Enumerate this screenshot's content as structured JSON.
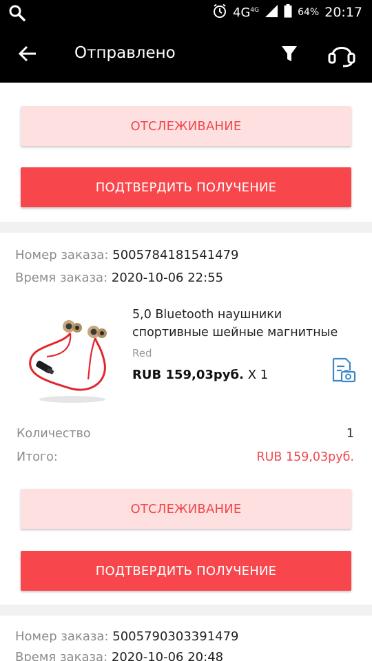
{
  "status_bar": {
    "network": "4G",
    "network_sup": "4G",
    "battery": "64%",
    "time": "20:17",
    "icons": [
      "search-icon",
      "alarm-icon",
      "signal-icon",
      "battery-icon"
    ]
  },
  "app_bar": {
    "title": "Отправлено",
    "icons": [
      "back-arrow-icon",
      "filter-icon",
      "headset-icon"
    ]
  },
  "orders": [
    {
      "track_label": "ОТСЛЕЖИВАНИЕ",
      "confirm_label": "ПОДТВЕРДИТЬ ПОЛУЧЕНИЕ"
    },
    {
      "order_number_label": "Номер заказа:",
      "order_number": "5005784181541479",
      "order_time_label": "Время заказа:",
      "order_time": "2020-10-06 22:55",
      "product": {
        "name_line1": "5,0 Bluetooth наушники",
        "name_line2": "спортивные шейные магнитные",
        "variant": "Red",
        "price": "RUB 159,03руб.",
        "qty": "X 1"
      },
      "quantity_label": "Количество",
      "quantity_value": "1",
      "total_label": "Итого:",
      "total_value": "RUB 159,03руб.",
      "track_label": "ОТСЛЕЖИВАНИЕ",
      "confirm_label": "ПОДТВЕРДИТЬ ПОЛУЧЕНИЕ"
    },
    {
      "order_number_label": "Номер заказа:",
      "order_number": "5005790303391479",
      "order_time_label": "Время заказа:",
      "order_time": "2020-10-06 20:48"
    }
  ],
  "colors": {
    "accent": "#f7474c",
    "accent_light": "#fde0df",
    "accent_text": "#f0484d",
    "bar": "#000000"
  }
}
